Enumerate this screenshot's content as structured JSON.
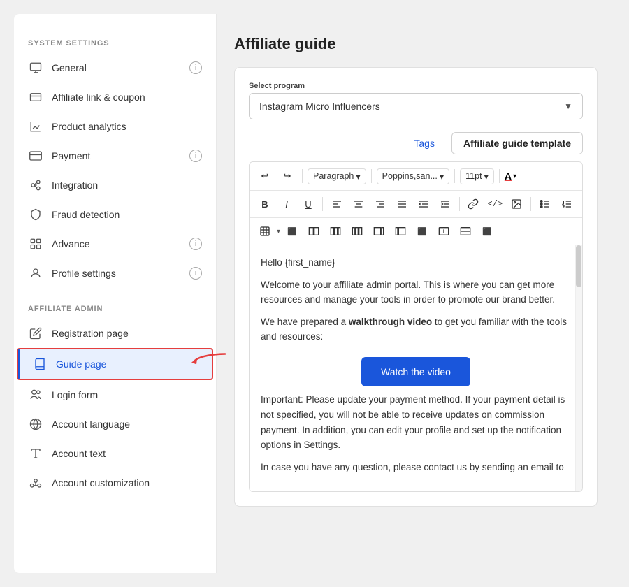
{
  "sidebar": {
    "system_settings_title": "SYSTEM SETTINGS",
    "affiliate_admin_title": "AFFILIATE ADMIN",
    "items_system": [
      {
        "id": "general",
        "label": "General",
        "icon": "monitor-icon",
        "badge": true
      },
      {
        "id": "affiliate-link",
        "label": "Affiliate link & coupon",
        "icon": "link-icon",
        "badge": false
      },
      {
        "id": "product-analytics",
        "label": "Product analytics",
        "icon": "chart-icon",
        "badge": false
      },
      {
        "id": "payment",
        "label": "Payment",
        "icon": "card-icon",
        "badge": true
      },
      {
        "id": "integration",
        "label": "Integration",
        "icon": "integration-icon",
        "badge": false
      },
      {
        "id": "fraud-detection",
        "label": "Fraud detection",
        "icon": "shield-icon",
        "badge": false
      },
      {
        "id": "advance",
        "label": "Advance",
        "icon": "grid-icon",
        "badge": true
      },
      {
        "id": "profile-settings",
        "label": "Profile settings",
        "icon": "user-icon",
        "badge": true
      }
    ],
    "items_affiliate": [
      {
        "id": "registration-page",
        "label": "Registration page",
        "icon": "edit-page-icon",
        "active": false
      },
      {
        "id": "guide-page",
        "label": "Guide page",
        "icon": "book-icon",
        "active": true
      },
      {
        "id": "login-form",
        "label": "Login form",
        "icon": "users-icon",
        "active": false
      },
      {
        "id": "account-language",
        "label": "Account language",
        "icon": "globe-icon",
        "active": false
      },
      {
        "id": "account-text",
        "label": "Account text",
        "icon": "text-icon",
        "active": false
      },
      {
        "id": "account-customization",
        "label": "Account customization",
        "icon": "customization-icon",
        "active": false
      }
    ]
  },
  "main": {
    "page_title": "Affiliate guide",
    "select_label": "Select program",
    "select_value": "Instagram Micro Influencers",
    "tabs": [
      {
        "id": "tags",
        "label": "Tags",
        "active": false
      },
      {
        "id": "affiliate-guide-template",
        "label": "Affiliate guide template",
        "active": true
      }
    ],
    "toolbar": {
      "undo": "↩",
      "redo": "↪",
      "paragraph": "Paragraph",
      "font": "Poppins,san...",
      "size": "11pt",
      "bold": "B",
      "italic": "I",
      "underline": "U",
      "align_left": "≡",
      "align_center": "≡",
      "align_right": "≡",
      "justify": "≡",
      "indent_left": "≡",
      "indent_right": "≡",
      "link": "🔗",
      "code": "</>",
      "image": "🖼",
      "list_bullet": "≡",
      "list_number": "≡"
    },
    "editor_content": {
      "greeting": "Hello {first_name}",
      "para1": "Welcome to your affiliate admin portal. This is where you can get more resources and manage your tools in order to promote our brand better.",
      "para2_before": "We have prepared a ",
      "para2_bold": "walkthrough video",
      "para2_after": " to get you familiar with the tools and resources:",
      "watch_btn": "Watch the video",
      "para3": "Important: Please update your payment method. If your payment detail is not specified, you will not be able to receive updates on commission payment. In addition, you can edit your profile and set up the notification options in Settings.",
      "para4": "In case you have any question, please contact us by sending an email to"
    }
  }
}
